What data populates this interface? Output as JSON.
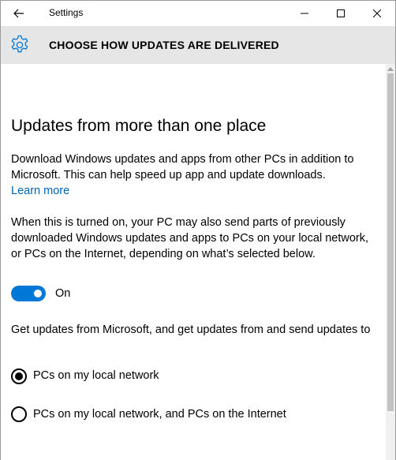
{
  "window": {
    "title": "Settings"
  },
  "header": {
    "title": "CHOOSE HOW UPDATES ARE DELIVERED",
    "icon": "gear-icon"
  },
  "section": {
    "title": "Updates from more than one place",
    "description": "Download Windows updates and apps from other PCs in addition to Microsoft. This can help speed up app and update downloads.",
    "learn_more": "Learn more",
    "toggle_description": "When this is turned on, your PC may also send parts of previously downloaded Windows updates and apps to PCs on your local network, or PCs on the Internet, depending on what’s selected below.",
    "toggle": {
      "state": "On",
      "enabled": true
    },
    "options_heading": "Get updates from Microsoft, and get updates from and send updates to",
    "options": [
      {
        "label": "PCs on my local network",
        "selected": true
      },
      {
        "label": "PCs on my local network, and PCs on the Internet",
        "selected": false
      }
    ]
  },
  "colors": {
    "accent": "#0078d7",
    "link": "#0063b1",
    "header_band": "#e6e6e6"
  }
}
